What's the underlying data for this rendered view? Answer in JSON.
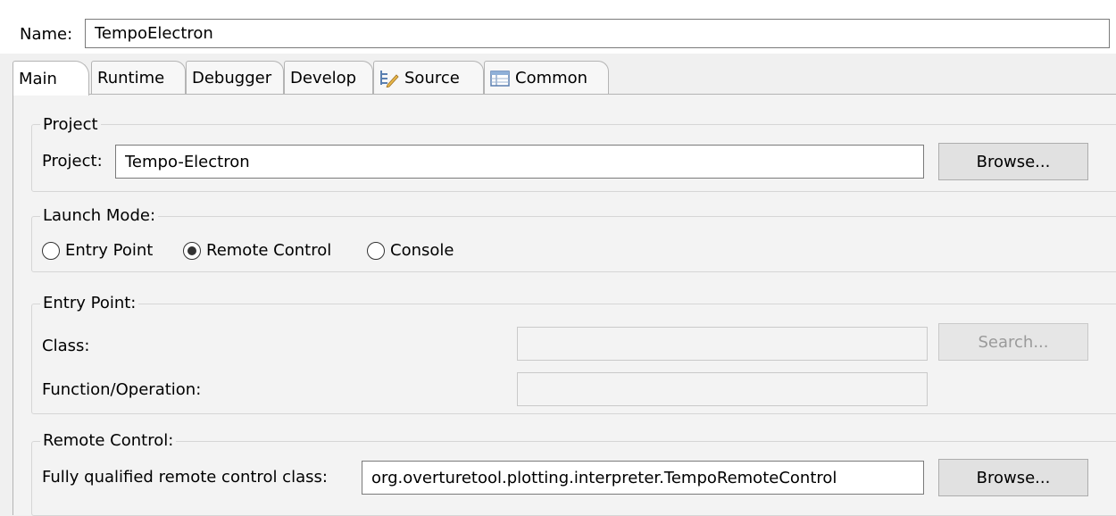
{
  "name": {
    "label": "Name:",
    "value": "TempoElectron"
  },
  "tabs": [
    {
      "label": "Main",
      "active": true
    },
    {
      "label": "Runtime",
      "active": false
    },
    {
      "label": "Debugger",
      "active": false
    },
    {
      "label": "Develop",
      "active": false
    },
    {
      "label": "Source",
      "active": false,
      "icon": "source-icon"
    },
    {
      "label": "Common",
      "active": false,
      "icon": "table-icon"
    }
  ],
  "project": {
    "group_title": "Project",
    "label": "Project:",
    "value": "Tempo-Electron",
    "browse_label": "Browse..."
  },
  "launch_mode": {
    "group_title": "Launch Mode:",
    "options": [
      {
        "label": "Entry Point",
        "checked": false
      },
      {
        "label": "Remote Control",
        "checked": true
      },
      {
        "label": "Console",
        "checked": false
      }
    ]
  },
  "entry_point": {
    "group_title": "Entry Point:",
    "class_label": "Class:",
    "class_value": "",
    "search_label": "Search...",
    "function_label": "Function/Operation:",
    "function_value": ""
  },
  "remote_control": {
    "group_title": "Remote Control:",
    "label": "Fully qualified remote control class:",
    "value": "org.overturetool.plotting.interpreter.TempoRemoteControl",
    "browse_label": "Browse..."
  },
  "colors": {
    "background": "#f0f0f0",
    "border": "#b4b4b4",
    "disabled_text": "#9a9a9a"
  }
}
